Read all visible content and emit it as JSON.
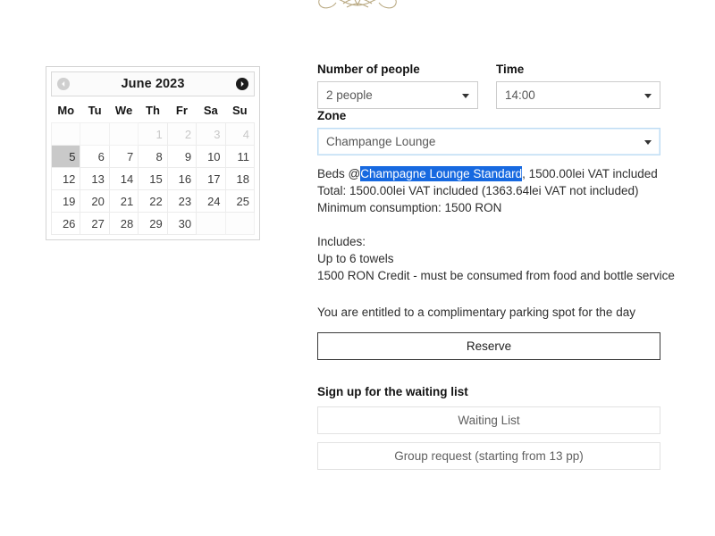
{
  "ornament": {
    "name": "floral-ornament",
    "color": "#b9a982"
  },
  "calendar": {
    "title": "June 2023",
    "prev_icon": "chevron-left-icon",
    "next_icon": "chevron-right-icon",
    "prev_enabled": false,
    "next_enabled": true,
    "weekdays": [
      "Mo",
      "Tu",
      "We",
      "Th",
      "Fr",
      "Sa",
      "Su"
    ],
    "selected_day": 5,
    "weeks": [
      [
        {
          "label": "",
          "state": "empty"
        },
        {
          "label": "",
          "state": "empty"
        },
        {
          "label": "",
          "state": "empty"
        },
        {
          "label": "1",
          "state": "disabled"
        },
        {
          "label": "2",
          "state": "disabled"
        },
        {
          "label": "3",
          "state": "disabled"
        },
        {
          "label": "4",
          "state": "disabled"
        }
      ],
      [
        {
          "label": "5",
          "state": "selected"
        },
        {
          "label": "6",
          "state": "available"
        },
        {
          "label": "7",
          "state": "available"
        },
        {
          "label": "8",
          "state": "available"
        },
        {
          "label": "9",
          "state": "available"
        },
        {
          "label": "10",
          "state": "available"
        },
        {
          "label": "11",
          "state": "available"
        }
      ],
      [
        {
          "label": "12",
          "state": "available"
        },
        {
          "label": "13",
          "state": "available"
        },
        {
          "label": "14",
          "state": "available"
        },
        {
          "label": "15",
          "state": "available"
        },
        {
          "label": "16",
          "state": "available"
        },
        {
          "label": "17",
          "state": "available"
        },
        {
          "label": "18",
          "state": "available"
        }
      ],
      [
        {
          "label": "19",
          "state": "available"
        },
        {
          "label": "20",
          "state": "available"
        },
        {
          "label": "21",
          "state": "available"
        },
        {
          "label": "22",
          "state": "available"
        },
        {
          "label": "23",
          "state": "available"
        },
        {
          "label": "24",
          "state": "available"
        },
        {
          "label": "25",
          "state": "available"
        }
      ],
      [
        {
          "label": "26",
          "state": "available"
        },
        {
          "label": "27",
          "state": "available"
        },
        {
          "label": "28",
          "state": "available"
        },
        {
          "label": "29",
          "state": "available"
        },
        {
          "label": "30",
          "state": "available"
        },
        {
          "label": "",
          "state": "empty"
        },
        {
          "label": "",
          "state": "empty"
        }
      ]
    ]
  },
  "form": {
    "people": {
      "label": "Number of people",
      "value": "2 people"
    },
    "time": {
      "label": "Time",
      "value": "14:00"
    },
    "zone": {
      "label": "Zone",
      "value": "Champange Lounge",
      "focused": true
    }
  },
  "info": {
    "beds_prefix": "Beds @",
    "beds_highlighted": "Champagne Lounge Standard",
    "beds_suffix": ", 1500.00lei VAT included",
    "total": "Total: 1500.00lei VAT included (1363.64lei VAT not included)",
    "minimum": "Minimum consumption: 1500 RON",
    "includes_title": "Includes:",
    "includes_towels": "Up to 6 towels",
    "includes_credit": "1500 RON Credit - must be consumed from food and bottle service",
    "parking": "You are entitled to a complimentary parking spot for the day"
  },
  "actions": {
    "reserve": "Reserve",
    "waiting_section_title": "Sign up for the waiting list",
    "waiting_list": "Waiting List",
    "group_request": "Group request (starting from 13 pp)"
  },
  "colors": {
    "selection_blue": "#1769e0",
    "focus_border": "#bedcf3",
    "selected_day_bg": "#c9c9c9"
  }
}
